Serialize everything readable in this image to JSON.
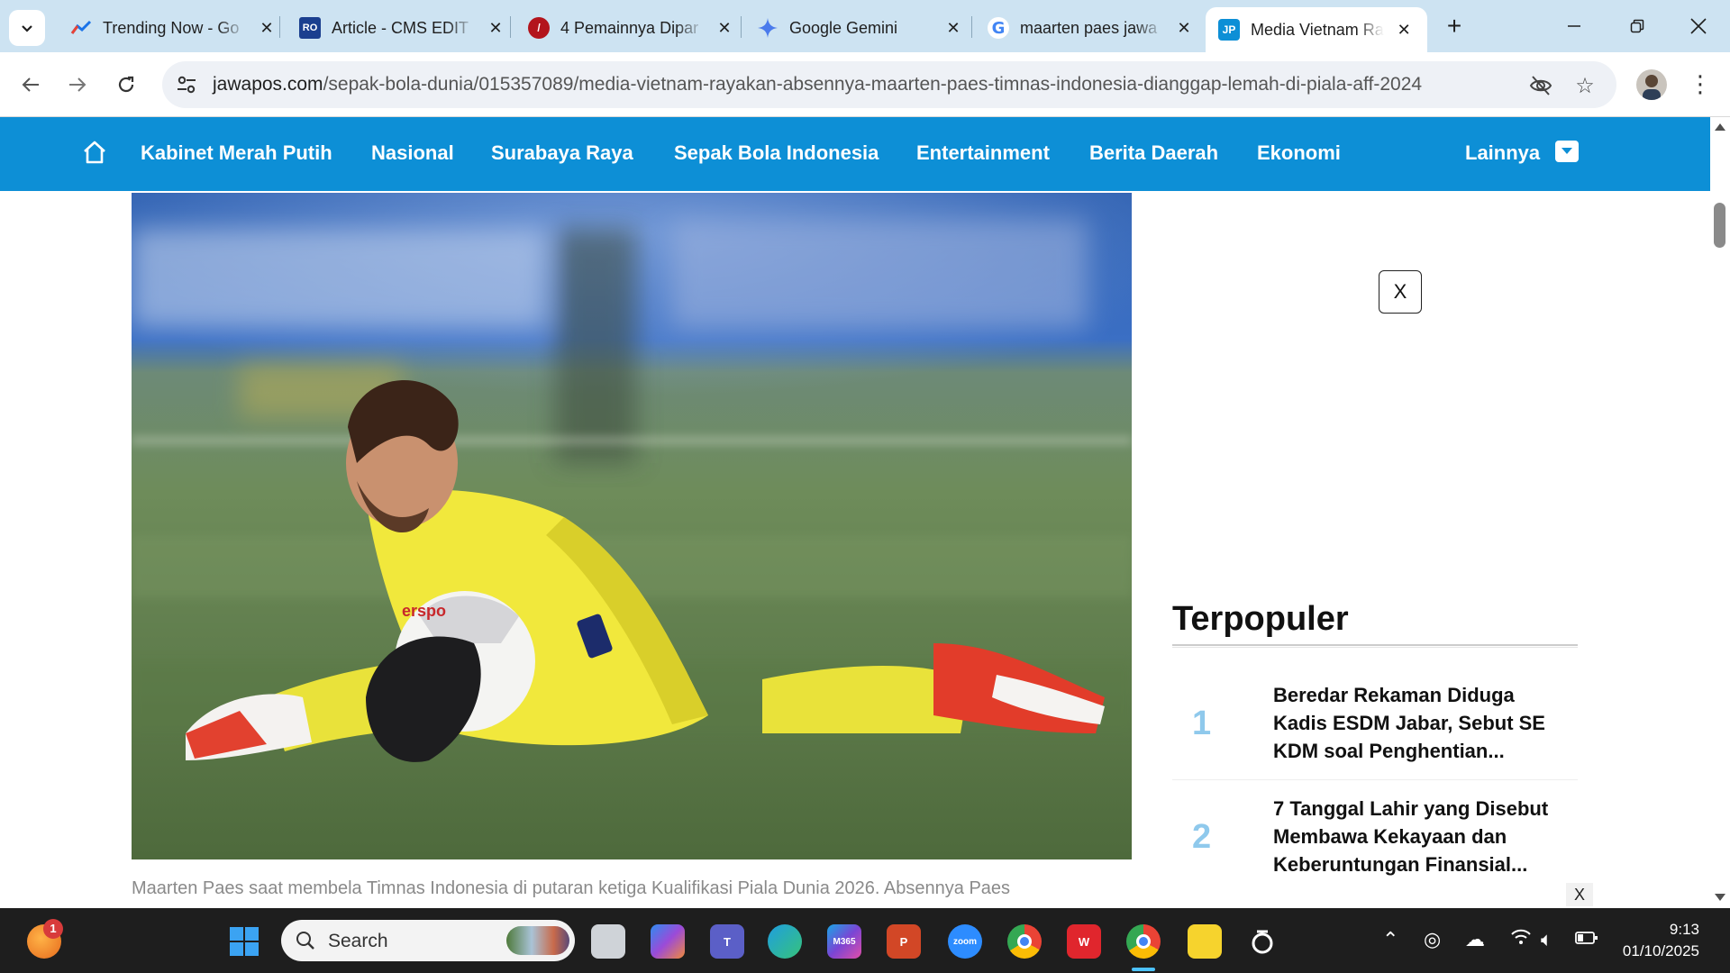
{
  "browser": {
    "tabs": [
      {
        "title": "Trending Now - Go",
        "icon": "trending-chart-icon",
        "color": "#1a73e8"
      },
      {
        "title": "Article - CMS EDIT",
        "icon": "cms-logo-icon",
        "color": "#1b3f8f"
      },
      {
        "title": "4 Pemainnya Dipar",
        "icon": "news-logo-icon",
        "color": "#b3141c"
      },
      {
        "title": "Google Gemini",
        "icon": "gemini-sparkle-icon",
        "color": "#4b7bec"
      },
      {
        "title": "maarten paes jawa",
        "icon": "google-g-icon",
        "color": "#4285f4"
      },
      {
        "title": "Media Vietnam Ra",
        "icon": "jawapos-logo-icon",
        "color": "#0d8fd6",
        "active": true
      }
    ],
    "url_host": "jawapos.com",
    "url_path": "/sepak-bola-dunia/015357089/media-vietnam-rayakan-absennya-maarten-paes-timnas-indonesia-dianggap-lemah-di-piala-aff-2024"
  },
  "nav": {
    "items": [
      "Kabinet Merah Putih",
      "Nasional",
      "Surabaya Raya",
      "Sepak Bola Indonesia",
      "Entertainment",
      "Berita Daerah",
      "Ekonomi"
    ],
    "more_label": "Lainnya",
    "accent": "#0d8fd6"
  },
  "article": {
    "caption": "Maarten Paes saat membela Timnas Indonesia di putaran ketiga Kualifikasi Piala Dunia 2026. Absennya Paes ",
    "jersey_text": "erspo"
  },
  "sidebar": {
    "ad_close": "X",
    "popular_title": "Terpopuler",
    "popular": [
      {
        "rank": "1",
        "title": "Beredar Rekaman Diduga Kadis ESDM Jabar, Sebut SE KDM soal Penghentian..."
      },
      {
        "rank": "2",
        "title": "7 Tanggal Lahir yang Disebut Membawa Kekayaan dan Keberuntungan Finansial..."
      }
    ],
    "ad_close_small": "X"
  },
  "taskbar": {
    "search_label": "Search",
    "notification_count": "1",
    "time": "9:13",
    "date": "01/10/2025",
    "apps": [
      "widgets-weather-icon",
      "windows-start-icon",
      "task-view-icon",
      "copilot-icon",
      "teams-icon",
      "edge-icon",
      "m365-icon",
      "powerpoint-icon",
      "zoom-icon",
      "chrome-icon",
      "wps-office-icon",
      "chrome-profile-icon",
      "sticky-notes-icon",
      "loop-icon"
    ]
  }
}
